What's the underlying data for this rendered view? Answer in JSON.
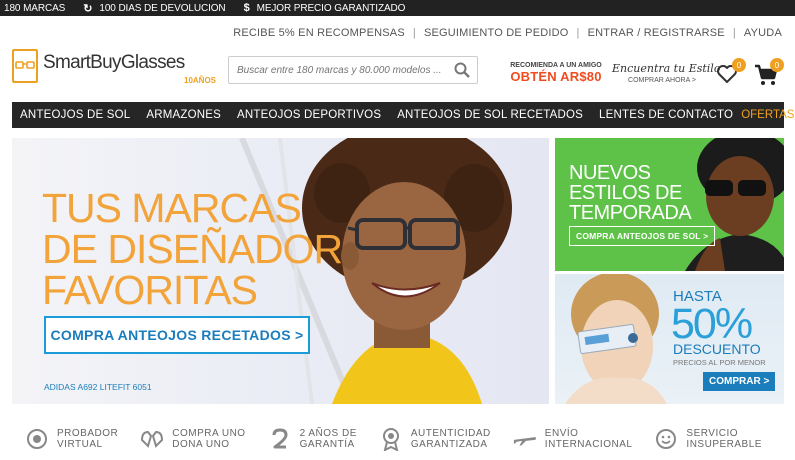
{
  "topbar": [
    {
      "icon": "",
      "label": "180 MARCAS"
    },
    {
      "icon": "↻",
      "label": "100 DIAS DE DEVOLUCION"
    },
    {
      "icon": "$",
      "label": "MEJOR PRECIO GARANTIZADO"
    }
  ],
  "util": [
    "RECIBE 5% EN RECOMPENSAS",
    "SEGUIMIENTO DE PEDIDO",
    "ENTRAR / REGISTRARSE",
    "AYUDA"
  ],
  "logo": {
    "name": "SmartBuyGlasses",
    "sub": "10AÑOS"
  },
  "search": {
    "placeholder": "Buscar entre 180 marcas y 80.000 modelos ..."
  },
  "promo_refer": {
    "line1": "RECOMIENDA A UN AMIGO",
    "line2": "OBTÉN AR$80"
  },
  "promo_style": {
    "line1": "Encuentra tu Estilo",
    "line2": "COMPRAR AHORA >"
  },
  "wishlist_count": "0",
  "cart_count": "0",
  "nav": [
    "ANTEOJOS DE SOL",
    "ARMAZONES",
    "ANTEOJOS DEPORTIVOS",
    "ANTEOJOS DE SOL RECETADOS",
    "LENTES DE CONTACTO"
  ],
  "nav_offer": "OFERTAS",
  "hero": {
    "l1": "TUS MARCAS",
    "l2": "DE DISEÑADOR",
    "l3": "FAVORITAS",
    "cta": "COMPRA ANTEOJOS RECETADOS >",
    "caption": "ADIDAS A692 LITEFIT 6051"
  },
  "side1": {
    "l1": "NUEVOS",
    "l2": "ESTILOS DE",
    "l3": "TEMPORADA",
    "cta": "COMPRA ANTEOJOS DE SOL >"
  },
  "side2": {
    "hasta": "HASTA",
    "pct": "50%",
    "desc": "DESCUENTO",
    "retail": "PRECIOS AL POR MENOR",
    "cta": "COMPRAR >"
  },
  "features": [
    {
      "icon": "camera-icon",
      "l1": "PROBADOR",
      "l2": "VIRTUAL"
    },
    {
      "icon": "hands-icon",
      "l1": "COMPRA UNO",
      "l2": "DONA UNO"
    },
    {
      "icon": "two-icon",
      "l1": "2 AÑOS DE",
      "l2": "GARANTÍA"
    },
    {
      "icon": "award-icon",
      "l1": "AUTENTICIDAD",
      "l2": "GARANTIZADA"
    },
    {
      "icon": "plane-icon",
      "l1": "ENVÍO",
      "l2": "INTERNACIONAL"
    },
    {
      "icon": "smile-icon",
      "l1": "SERVICIO",
      "l2": "INSUPERABLE"
    }
  ],
  "colors": {
    "accent": "#f0a020",
    "nav_bg": "#262626",
    "blue": "#1b7dbc",
    "green": "#5ec249"
  }
}
